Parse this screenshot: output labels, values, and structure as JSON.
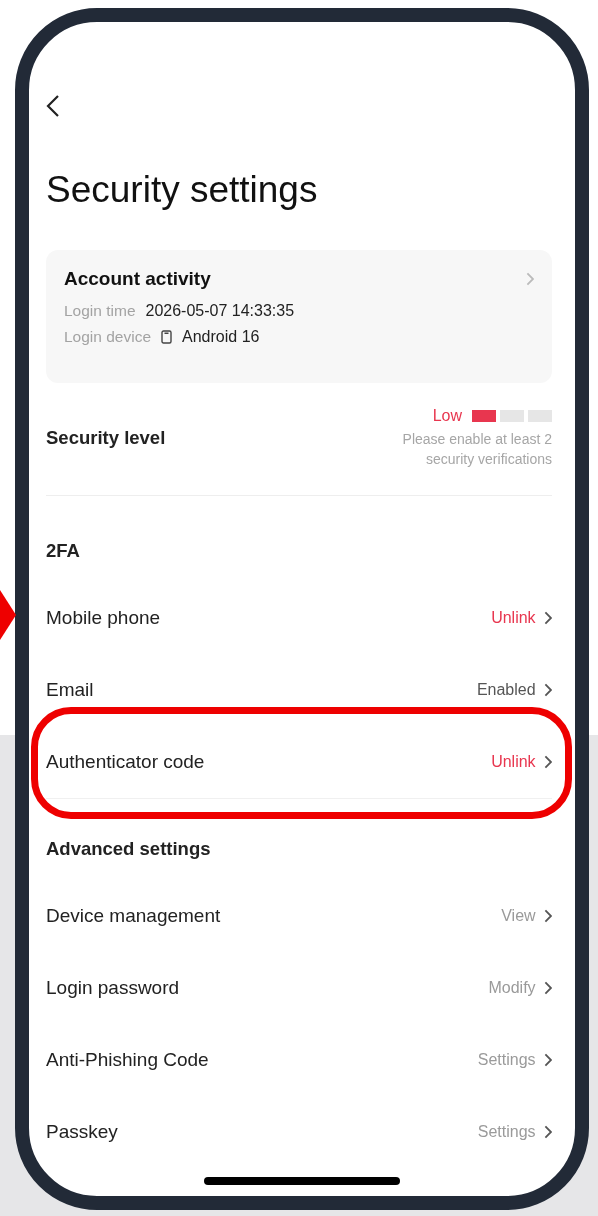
{
  "title": "Security settings",
  "account_activity": {
    "title": "Account activity",
    "fields": [
      {
        "label": "Login time",
        "value": "2026-05-07 14:33:35",
        "kind": "text"
      },
      {
        "label": "Login device",
        "value": "Android 16",
        "kind": "device"
      }
    ]
  },
  "security_level": {
    "label": "Security level",
    "rating": "Low",
    "level": 0.33,
    "hint": "Please enable at least 2 security verifications"
  },
  "sections": [
    {
      "title": "2FA",
      "items": [
        {
          "label": "Mobile phone",
          "value": "Unlink",
          "kind": "unlinked",
          "highlighted": false,
          "pointed": true
        },
        {
          "label": "Email",
          "value": "Enabled",
          "kind": "enabled",
          "highlighted": false,
          "pointed": false
        },
        {
          "label": "Authenticator code",
          "value": "Unlink",
          "kind": "unlinked",
          "highlighted": true,
          "pointed": false
        }
      ]
    },
    {
      "title": "Advanced settings",
      "items": [
        {
          "label": "Device management",
          "value": "View",
          "kind": "action",
          "highlighted": false,
          "pointed": false
        },
        {
          "label": "Login password",
          "value": "Modify",
          "kind": "action",
          "highlighted": false,
          "pointed": false
        },
        {
          "label": "Anti-Phishing Code",
          "value": "Settings",
          "kind": "action",
          "highlighted": false,
          "pointed": false
        },
        {
          "label": "Passkey",
          "value": "Settings",
          "kind": "action",
          "highlighted": false,
          "pointed": false
        }
      ]
    }
  ]
}
